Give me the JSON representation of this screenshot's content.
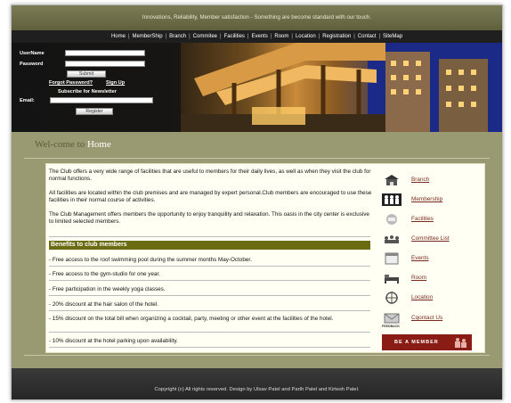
{
  "header": {
    "tagline": "Innovations, Reliability, Member satisfaction - Something are become standard with our touch."
  },
  "nav": {
    "items": [
      "Home",
      "MemberShip",
      "Branch",
      "Commitee",
      "Facilities",
      "Events",
      "Room",
      "Location",
      "Registration",
      "Contact",
      "SiteMap"
    ],
    "separator": "|"
  },
  "login": {
    "username_label": "UserName",
    "password_label": "Password",
    "submit_label": "Submit",
    "forgot_label": "Forgot Password?",
    "signup_label": "Sign Up",
    "newsletter_label": "Subscribe for Newsletter",
    "email_label": "Email:",
    "register_label": "Register"
  },
  "welcome": {
    "prefix": "Wel-come to",
    "page": "Home"
  },
  "intro": {
    "p1": "The Club offers a very wide range of facilities that are useful to members for their daily lives, as well as when they visit the club for normal functions.",
    "p2": "All facilities are located within the club premises and are managed by expert personal.Club members are encouraged to use these facilities in their normal course of activities.",
    "p3": "The Club Management offers members the opportunity to enjoy tranquility and relaxation. This oasis in the city center is exclusive to limited selected members."
  },
  "benefits": {
    "heading": "Benefits to club members",
    "items": [
      "- Free access to the roof swimming pool during the summer months May-October.",
      "- Free access to the gym-studio for one year.",
      "- Free participation in the weekly yoga classes.",
      "- 20% discount at the hair salon of the hotel.",
      "- 15% discount on the total bill when organizing a cocktail, party, meeting or other event at the facilities of the hotel.",
      "- 10% discount at the hotel parking upon availability."
    ]
  },
  "sidebar": {
    "items": [
      {
        "label": "Branch",
        "icon": "building-icon"
      },
      {
        "label": "Membership",
        "icon": "people-icon"
      },
      {
        "label": "Facilities",
        "icon": "facilities-icon"
      },
      {
        "label": "Committee List",
        "icon": "committee-icon"
      },
      {
        "label": "Events",
        "icon": "calendar-icon"
      },
      {
        "label": "Room",
        "icon": "bed-icon"
      },
      {
        "label": "Location",
        "icon": "compass-icon"
      },
      {
        "label": "Cqontact Us",
        "icon": "mail-icon"
      }
    ],
    "feedback_label": "FEEDBACK",
    "member_banner": "BE A MEMBER"
  },
  "footer": {
    "copyright": "Copyright (c) All rights reserved. Design by Utsav Patel and Parth Patel and Kirtesh Patel."
  },
  "colors": {
    "page_bg": "#9a9a72",
    "nav_bg": "#1f1f1f",
    "benefits_bar": "#6b6b12",
    "link": "#7a2a1e",
    "member_banner": "#8a1c16"
  }
}
